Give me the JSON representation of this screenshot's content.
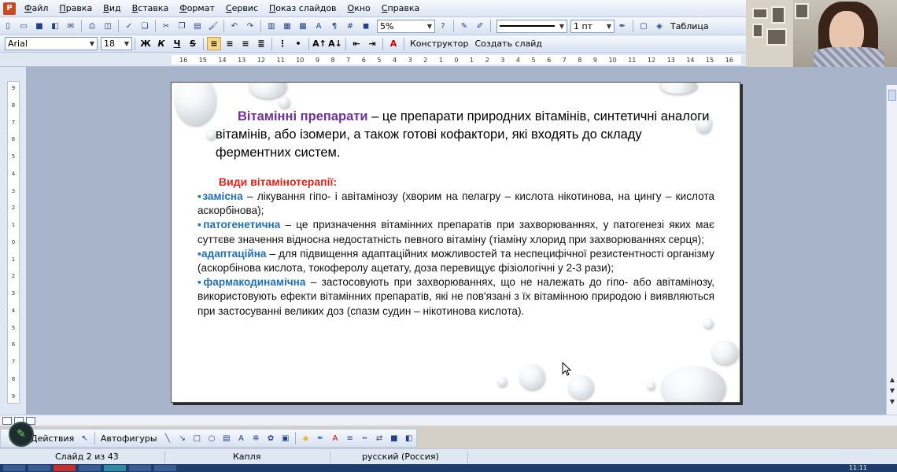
{
  "menu": [
    "Файл",
    "Правка",
    "Вид",
    "Вставка",
    "Формат",
    "Сервис",
    "Показ слайдов",
    "Окно",
    "Справка"
  ],
  "toolbar1": {
    "zoom": "5%",
    "line_weight": "1 пт",
    "table_label": "Таблица"
  },
  "toolbar2": {
    "font": "Arial",
    "font_size": "18",
    "bold": "Ж",
    "italic": "К",
    "underline": "Ч",
    "strike": "S",
    "designer_label": "Конструктор",
    "new_slide_label": "Создать слайд"
  },
  "ruler_h": [
    "16",
    "15",
    "14",
    "13",
    "12",
    "11",
    "10",
    "9",
    "8",
    "7",
    "6",
    "5",
    "4",
    "3",
    "2",
    "1",
    "0",
    "1",
    "2",
    "3",
    "4",
    "5",
    "6",
    "7",
    "8",
    "9",
    "10",
    "11",
    "12",
    "13",
    "14",
    "15",
    "16"
  ],
  "ruler_v": [
    "9",
    "8",
    "7",
    "6",
    "5",
    "4",
    "3",
    "2",
    "1",
    "0",
    "1",
    "2",
    "3",
    "4",
    "5",
    "6",
    "7",
    "8",
    "9"
  ],
  "slide": {
    "title_keyword": "Вітамінні препарати",
    "title_rest": " – це препарати природних вітамінів, синтетичні аналоги вітамінів, або ізомери, а також готові кофактори, які входять до складу ферментних систем.",
    "types_heading": "Види вітамінотерапії:",
    "items": [
      {
        "bullet": "▪",
        "term": "замісна",
        "text": " –  лікування гіпо- і авітамінозу (хворим на пелагру – кислота нікотинова, на цингу – кислота аскорбінова);"
      },
      {
        "bullet": "▪",
        "term": "патогенетична",
        "text": " – це призначення вітамінних препаратів при захворюваннях, у патогенезі яких має суттєве значення відносна недостатність певного вітаміну (тіаміну хлорид при захворюваннях серця);"
      },
      {
        "bullet": "▪",
        "term": "адаптаційна",
        "text": "  –  для  підвищення  адаптаційних  можливостей  та  неспецифічної резистентності організму (аскорбінова кислота, токоферолу ацетату, доза перевищує фізіологічні у 2-3 рази);"
      },
      {
        "bullet": "▪",
        "term": "фармакодинамічна",
        "text": " – застосовують при захворюваннях, що не належать до гіпо- або авітамінозу,  використовують ефекти вітамінних препаратів, які не пов'язані з їх вітамінною природою і виявляються при застосуванні великих доз (спазм судин – нікотинова кислота)."
      }
    ]
  },
  "drawbar": {
    "actions_label": "Действия",
    "autoshapes_label": "Автофигуры"
  },
  "status": {
    "slide": "Слайд 2 из 43",
    "design": "Капля",
    "language": "русский (Россия)"
  },
  "clock": "11:11",
  "colors": {
    "keyword": "#7030a0",
    "heading": "#e2231a",
    "term": "#1f70b8"
  }
}
